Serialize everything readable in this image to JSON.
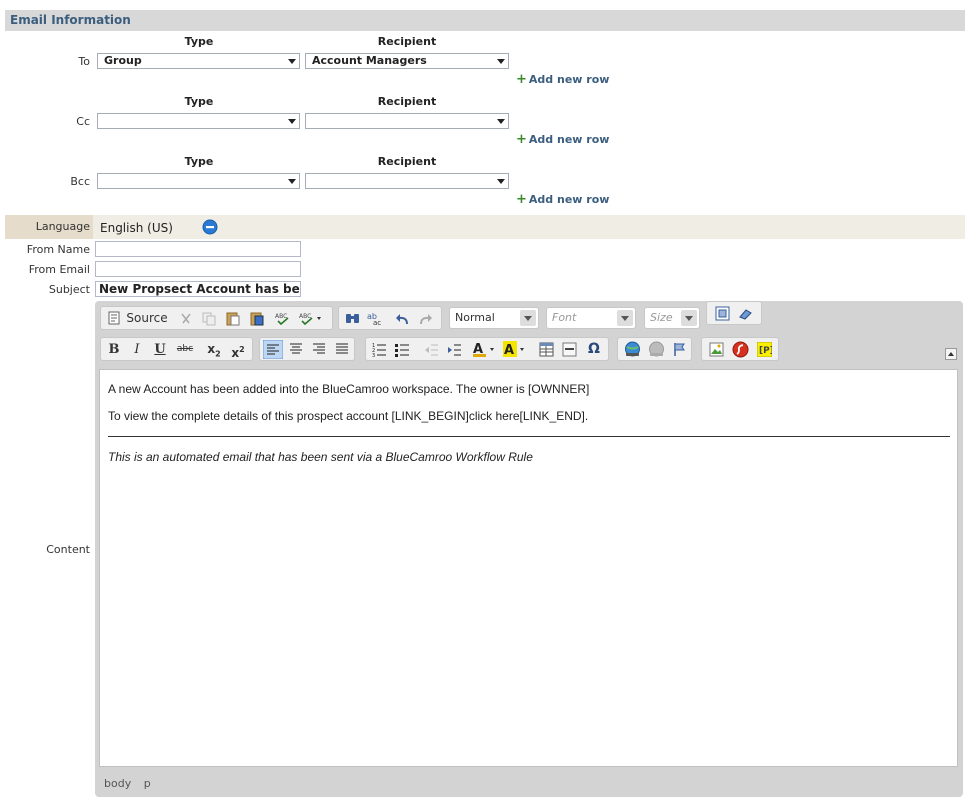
{
  "section": {
    "title": "Email Information"
  },
  "recipients": {
    "type_header": "Type",
    "recipient_header": "Recipient",
    "add_row_label": "Add new row",
    "rows": [
      {
        "label": "To",
        "type": "Group",
        "recipient": "Account Managers"
      },
      {
        "label": "Cc",
        "type": "",
        "recipient": ""
      },
      {
        "label": "Bcc",
        "type": "",
        "recipient": ""
      }
    ]
  },
  "language": {
    "label": "Language",
    "value": "English (US)"
  },
  "from_name": {
    "label": "From Name",
    "value": ""
  },
  "from_email": {
    "label": "From Email",
    "value": ""
  },
  "subject": {
    "label": "Subject",
    "value": "New Propsect Account has bee"
  },
  "content": {
    "label": "Content",
    "toolbar": {
      "source_label": "Source",
      "format_value": "Normal",
      "font_placeholder": "Font",
      "size_placeholder": "Size"
    },
    "paragraphs": [
      "A new Account has been added into the BlueCamroo workspace. The owner is  [OWNNER]",
      "To view the complete details of this prospect account [LINK_BEGIN]click here[LINK_END].",
      "This is an automated email that has been sent via a BlueCamroo Workflow Rule"
    ],
    "status_path": [
      "body",
      "p"
    ]
  },
  "colors": {
    "header_bg": "#d8d8d8",
    "header_text": "#3b5e7e",
    "link": "#3b5e7e",
    "plus": "#3a8a2a",
    "language_bar": "#efede4"
  }
}
